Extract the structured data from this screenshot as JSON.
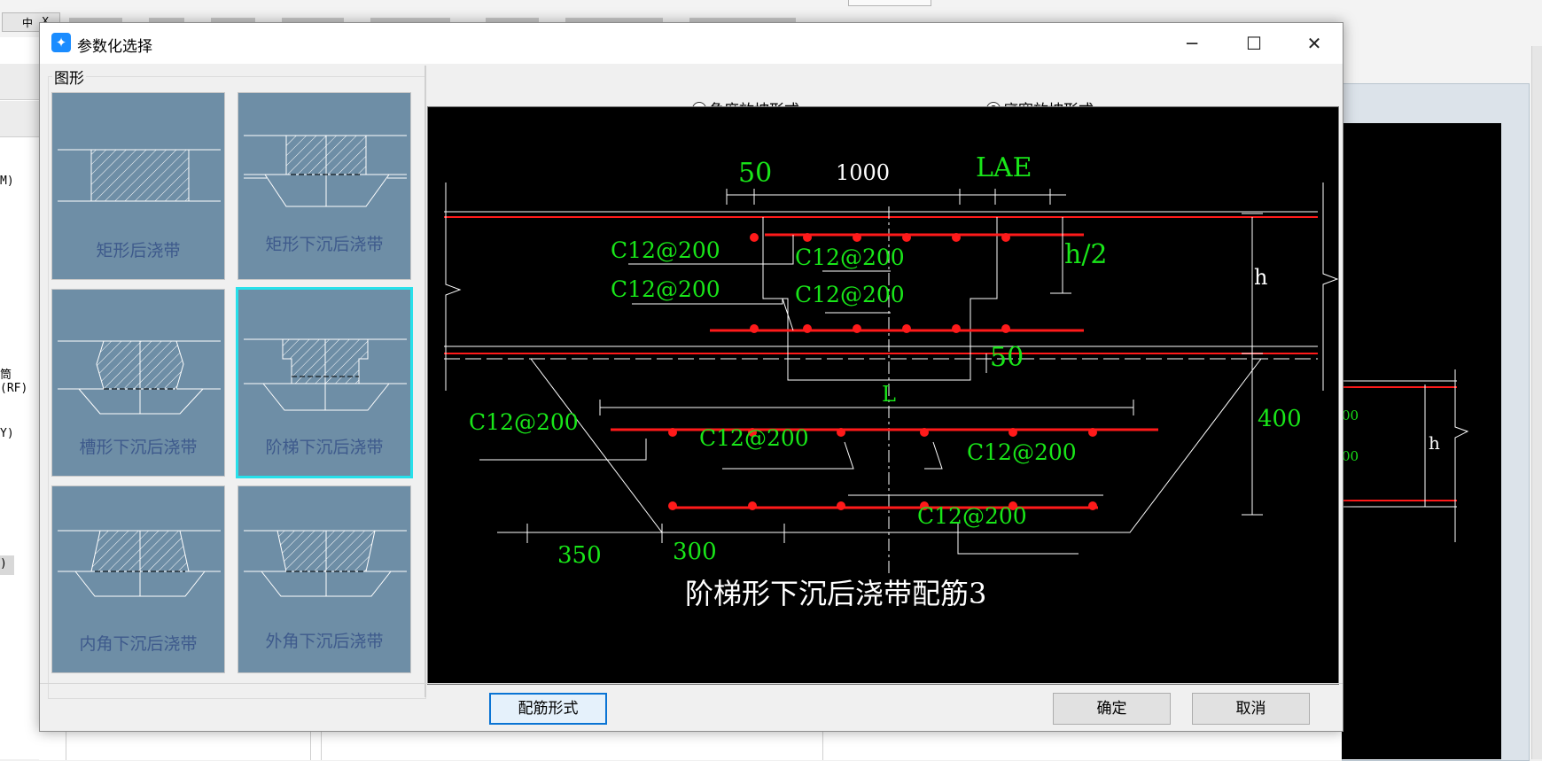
{
  "background": {
    "pin_label": "中",
    "close_mark": "X",
    "left_panel_labels": [
      "M)",
      "筒(RF)",
      "Y)",
      ")"
    ],
    "right_preview": {
      "rebar_labels": [
        "00",
        "00"
      ],
      "dim_label": "h"
    }
  },
  "dialog": {
    "title": "参数化选择",
    "window_buttons": {
      "minimize": "─",
      "maximize": "☐",
      "close": "✕"
    },
    "shape_group_label": "图形",
    "shapes": [
      {
        "label": "矩形后浇带",
        "selected": false
      },
      {
        "label": "矩形下沉后浇带",
        "selected": false
      },
      {
        "label": "槽形下沉后浇带",
        "selected": false
      },
      {
        "label": "阶梯下沉后浇带",
        "selected": true
      },
      {
        "label": "内角下沉后浇带",
        "selected": false
      },
      {
        "label": "外角下沉后浇带",
        "selected": false
      }
    ],
    "slope_options": [
      {
        "label": "角度放坡形式",
        "checked": false
      },
      {
        "label": "底宽放坡形式",
        "checked": true
      }
    ],
    "preview": {
      "title": "阶梯形下沉后浇带配筋3",
      "dimensions": {
        "d50_top": "50",
        "d1000": "1000",
        "lae": "LAE",
        "h_half": "h/2",
        "h": "h",
        "d50_mid": "50",
        "L": "L",
        "d400": "400",
        "d350": "350",
        "d300": "300"
      },
      "rebar_labels": [
        "C12@200",
        "C12@200",
        "C12@200",
        "C12@200",
        "C12@200",
        "C12@200",
        "C12@200",
        "C12@200"
      ]
    },
    "buttons": {
      "rebar_form": "配筋形式",
      "ok": "确定",
      "cancel": "取消"
    }
  },
  "colors": {
    "tile_bg": "#6e8ea6",
    "tile_selected_border": "#27e0ea",
    "cad_green": "#19e619",
    "cad_red": "#ff1a1a",
    "primary_blue": "#0a74d4"
  }
}
